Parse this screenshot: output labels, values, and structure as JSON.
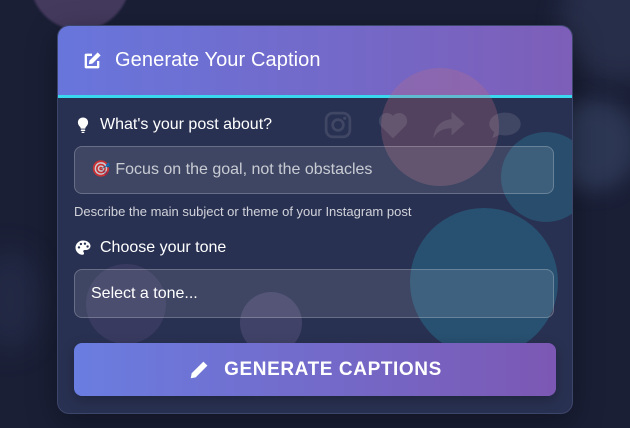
{
  "card": {
    "title": "Generate Your Caption",
    "title_icon": "edit-icon"
  },
  "background_icons": [
    "instagram-icon",
    "heart-icon",
    "share-icon",
    "comment-icon"
  ],
  "topic": {
    "label": "What's your post about?",
    "label_icon": "lightbulb-icon",
    "placeholder": "🎯 Focus on the goal, not the obstacles",
    "value": "",
    "help": "Describe the main subject or theme of your Instagram post"
  },
  "tone": {
    "label": "Choose your tone",
    "label_icon": "palette-icon",
    "selected": "Select a tone..."
  },
  "generate_button": {
    "label": "GENERATE CAPTIONS",
    "icon": "pencil-icon"
  },
  "colors": {
    "header_start": "#6876dc",
    "header_end": "#7d5eb8",
    "accent_line": "#3ad8ef",
    "button_start": "#6a7de0",
    "button_end": "#7c58b4",
    "page_bg": "#1a1f36"
  }
}
